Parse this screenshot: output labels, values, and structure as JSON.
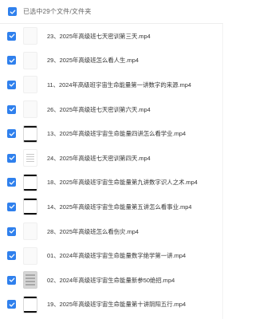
{
  "header": {
    "selection_label": "已选中29个文件/文件夹"
  },
  "colors": {
    "checkbox": "#2f80ed",
    "text": "#333333",
    "header_text": "#666666"
  },
  "files": [
    {
      "name": "23、2025年高级班七天密训第三天.mp4",
      "thumb": "blank"
    },
    {
      "name": "29、2025年高级班怎么看人生.mp4",
      "thumb": "blank"
    },
    {
      "name": "11、2024年高级班宇宙生命能量第一讲数字的来源.mp4",
      "thumb": "blank"
    },
    {
      "name": "26、2025年高级班七天密训第六天.mp4",
      "thumb": "blank"
    },
    {
      "name": "13、2025年高级班宇宙生命能量四讲怎么看学业.mp4",
      "thumb": "dark"
    },
    {
      "name": "24、2025年高级班七天密训第四天.mp4",
      "thumb": "doc"
    },
    {
      "name": "18、2025年高级班宇宙生命能量第九讲数字识人之术.mp4",
      "thumb": "dark"
    },
    {
      "name": "14、2025年高级班宇宙生命能量第五讲怎么看事业.mp4",
      "thumb": "dark"
    },
    {
      "name": "28、2025年高级班怎么看伤灾.mp4",
      "thumb": "blank"
    },
    {
      "name": "01、2024年高级班宇宙生命能量数字绝学第一讲.mp4",
      "thumb": "blank"
    },
    {
      "name": "02、2024年高级班宇宙生命能量新参50绝招.mp4",
      "thumb": "gray"
    },
    {
      "name": "19、2025年高级班宇宙生命能量第十讲阴阳五行.mp4",
      "thumb": "dark"
    }
  ]
}
